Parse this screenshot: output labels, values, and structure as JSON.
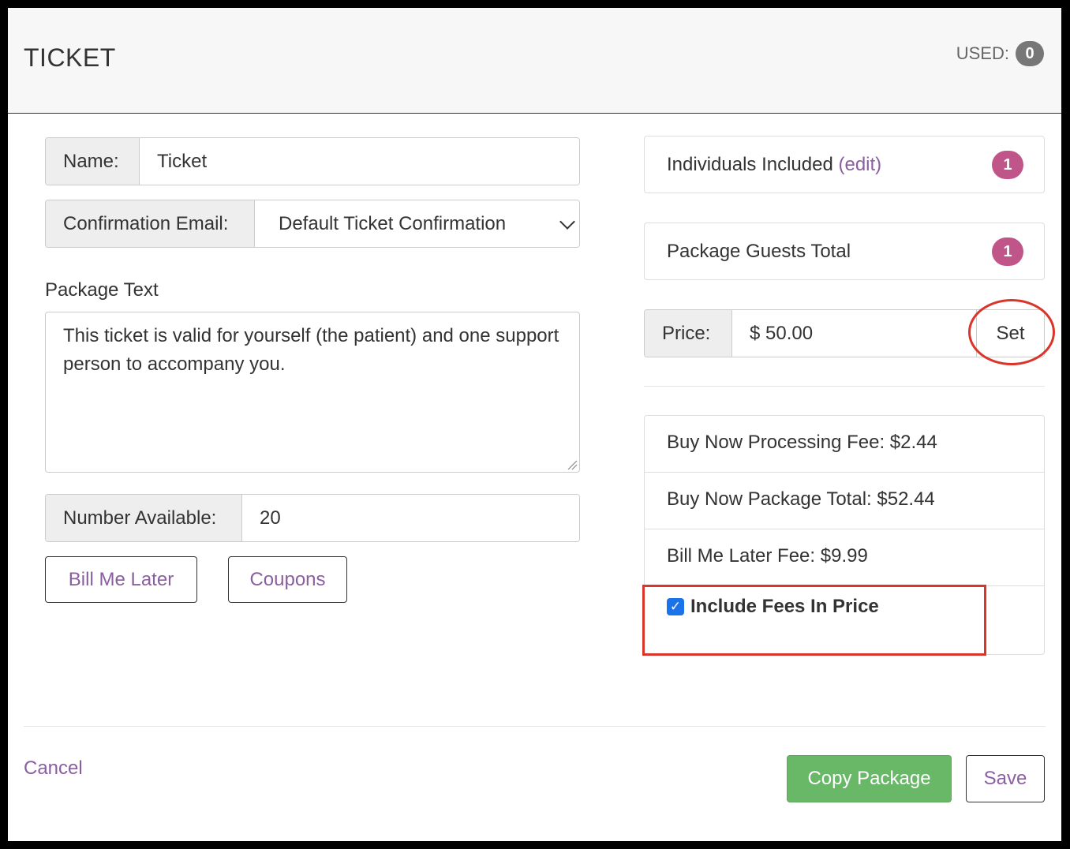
{
  "header": {
    "title": "TICKET",
    "used_label": "USED:",
    "used_count": "0"
  },
  "form": {
    "name_label": "Name:",
    "name_value": "Ticket",
    "confirmation_label": "Confirmation Email:",
    "confirmation_value": "Default Ticket Confirmation",
    "package_text_label": "Package Text",
    "package_text_value": "This ticket is valid for yourself (the patient) and one support person to accompany you.",
    "number_available_label": "Number Available:",
    "number_available_value": "20",
    "bill_me_later_button": "Bill Me Later",
    "coupons_button": "Coupons"
  },
  "summary": {
    "individuals_label": "Individuals Included",
    "individuals_edit": "(edit)",
    "individuals_count": "1",
    "guests_label": "Package Guests Total",
    "guests_count": "1",
    "price_label": "Price:",
    "price_value": "$ 50.00",
    "set_button": "Set"
  },
  "fees": {
    "processing_fee": "Buy Now Processing Fee: $2.44",
    "package_total": "Buy Now Package Total: $52.44",
    "bill_later_fee": "Bill Me Later Fee: $9.99",
    "include_fees_label": "Include Fees In Price",
    "include_fees_checked": true
  },
  "footer": {
    "cancel": "Cancel",
    "copy_package": "Copy Package",
    "save": "Save"
  },
  "colors": {
    "accent_purple": "#8a5fa0",
    "badge_pink": "#c0558a",
    "success_green": "#68b868",
    "annotation_red": "#d9352a",
    "checkbox_blue": "#1a73e8"
  }
}
